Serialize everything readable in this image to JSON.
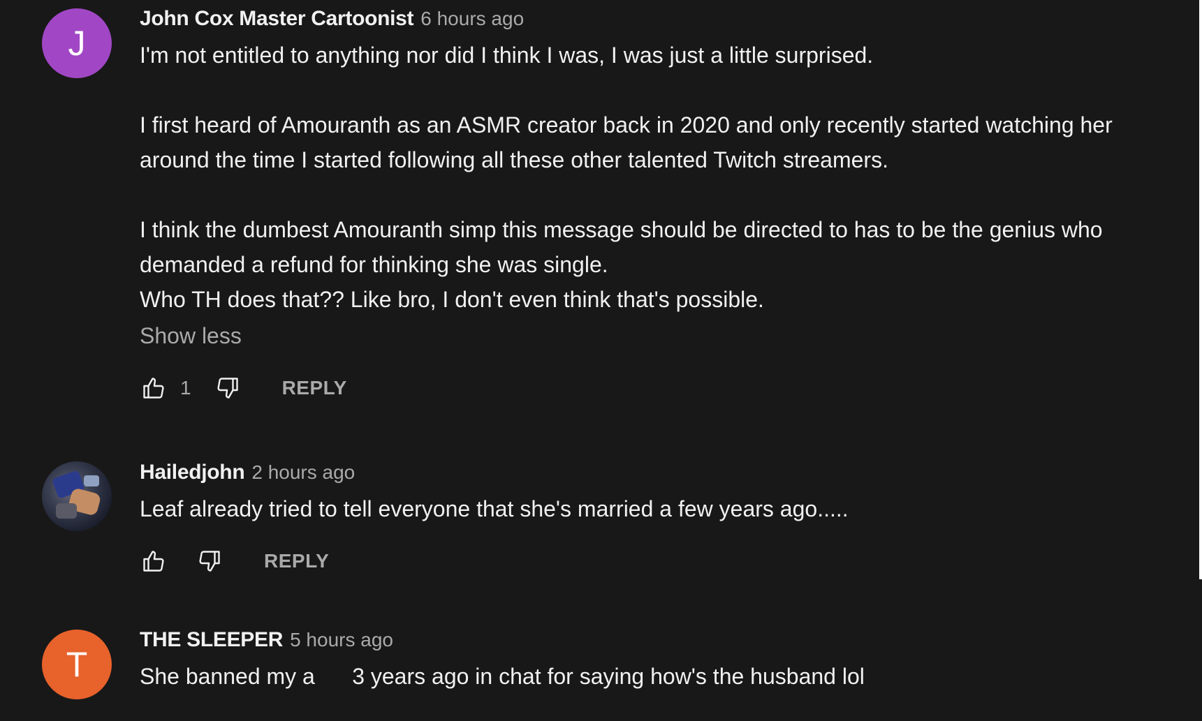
{
  "comments": [
    {
      "avatar_letter": "J",
      "avatar_color": "#a147c5",
      "author": "John Cox Master Cartoonist",
      "time": "6 hours ago",
      "paragraphs": [
        "I'm not entitled to anything nor did I think I was, I was just a little surprised.",
        "I first heard of Amouranth as an ASMR creator back in 2020 and only recently started watching her around the time I started following all these other talented Twitch streamers.",
        "I think the dumbest Amouranth simp this message should be directed to has to be the genius who demanded a refund for thinking she was single.\nWho TH does that?? Like bro, I don't even think that's possible."
      ],
      "show_less": "Show less",
      "likes": "1",
      "reply": "REPLY"
    },
    {
      "avatar_letter": "",
      "author": "Hailedjohn",
      "time": "2 hours ago",
      "text": "Leaf already tried to tell everyone that she's married a few years ago.....",
      "reply": "REPLY"
    },
    {
      "avatar_letter": "T",
      "avatar_color": "#e8622c",
      "author": "THE SLEEPER",
      "time": "5 hours ago",
      "text": "She banned my a      3 years ago in chat for saying how's the husband lol"
    }
  ],
  "icons": {
    "like": "thumbs-up-icon",
    "dislike": "thumbs-down-icon"
  }
}
